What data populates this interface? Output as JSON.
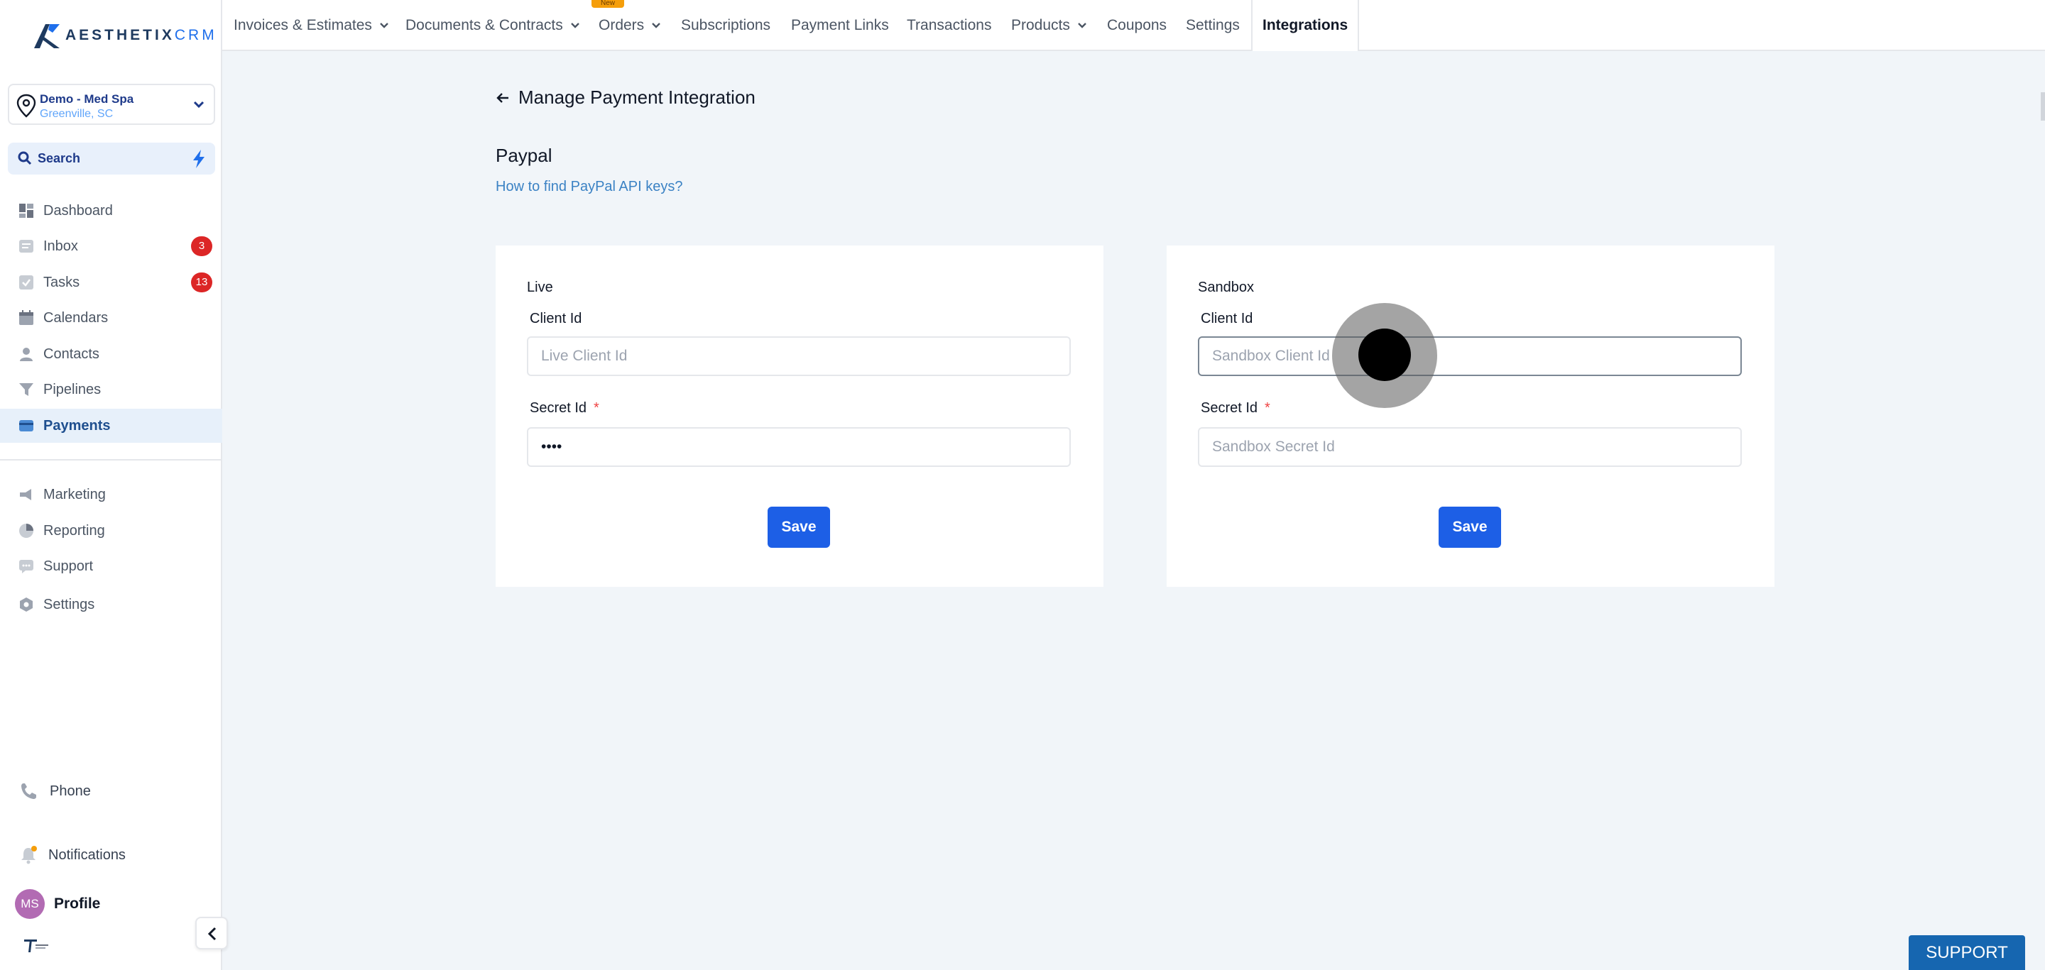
{
  "brand": {
    "name_bold": "AESTHETIX",
    "name_light": "CRM"
  },
  "location": {
    "name": "Demo - Med Spa",
    "city": "Greenville, SC"
  },
  "search": {
    "label": "Search"
  },
  "sidebar": {
    "items": [
      {
        "label": "Dashboard",
        "icon": "dashboard-icon"
      },
      {
        "label": "Inbox",
        "icon": "inbox-icon",
        "badge": "3"
      },
      {
        "label": "Tasks",
        "icon": "tasks-icon",
        "badge": "13"
      },
      {
        "label": "Calendars",
        "icon": "calendar-icon"
      },
      {
        "label": "Contacts",
        "icon": "contacts-icon"
      },
      {
        "label": "Pipelines",
        "icon": "pipelines-icon"
      },
      {
        "label": "Payments",
        "icon": "payments-icon",
        "active": true
      },
      {
        "label": "Marketing",
        "icon": "marketing-icon"
      },
      {
        "label": "Reporting",
        "icon": "reporting-icon"
      },
      {
        "label": "Support",
        "icon": "support-icon"
      },
      {
        "label": "Settings",
        "icon": "settings-icon"
      }
    ],
    "phone": "Phone",
    "notifications": "Notifications",
    "profile_initials": "MS",
    "profile": "Profile"
  },
  "topnav": {
    "tabs": [
      {
        "label": "Invoices & Estimates",
        "dropdown": true
      },
      {
        "label": "Documents & Contracts",
        "dropdown": true
      },
      {
        "label": "Orders",
        "dropdown": true
      },
      {
        "label": "Subscriptions"
      },
      {
        "label": "Payment Links"
      },
      {
        "label": "Transactions"
      },
      {
        "label": "Products",
        "dropdown": true
      },
      {
        "label": "Coupons"
      },
      {
        "label": "Settings"
      },
      {
        "label": "Integrations",
        "active": true
      }
    ],
    "new_tag": "New"
  },
  "main": {
    "back_title": "Manage Payment Integration",
    "section_title": "Paypal",
    "help_link": "How to find PayPal API keys?",
    "live": {
      "title": "Live",
      "client_label": "Client Id",
      "client_placeholder": "Live Client Id",
      "client_value": "",
      "secret_label": "Secret Id",
      "secret_value": "••••",
      "save": "Save"
    },
    "sandbox": {
      "title": "Sandbox",
      "client_label": "Client Id",
      "client_placeholder": "Sandbox Client Id",
      "client_value": "",
      "secret_label": "Secret Id",
      "secret_placeholder": "Sandbox Secret Id",
      "save": "Save"
    },
    "required_mark": "*"
  },
  "support_button": "SUPPORT",
  "colors": {
    "accent": "#1d5fe6",
    "active_nav_bg": "#e7f0fa",
    "badge": "#dc2626",
    "support": "#1666b0"
  }
}
